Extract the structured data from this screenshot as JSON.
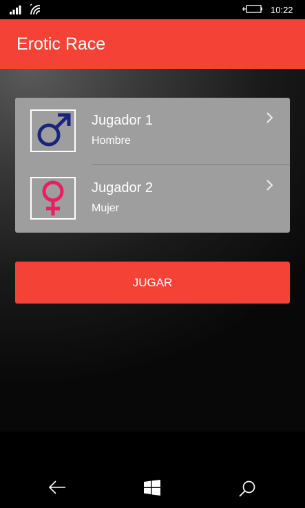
{
  "status_bar": {
    "time": "10:22",
    "icons": [
      "signal-icon",
      "wifi-icon",
      "battery-charging-icon"
    ]
  },
  "app_bar": {
    "title": "Erotic Race",
    "color": "#f44336"
  },
  "players": [
    {
      "name": "Jugador 1",
      "gender": "Hombre",
      "icon": "male-symbol-icon",
      "icon_color": "#1a237e"
    },
    {
      "name": "Jugador 2",
      "gender": "Mujer",
      "icon": "female-symbol-icon",
      "icon_color": "#e91e63"
    }
  ],
  "play_button": {
    "label": "JUGAR",
    "color": "#f44336"
  },
  "nav_bar": {
    "icons": [
      "back-arrow-icon",
      "windows-logo-icon",
      "search-icon"
    ]
  }
}
